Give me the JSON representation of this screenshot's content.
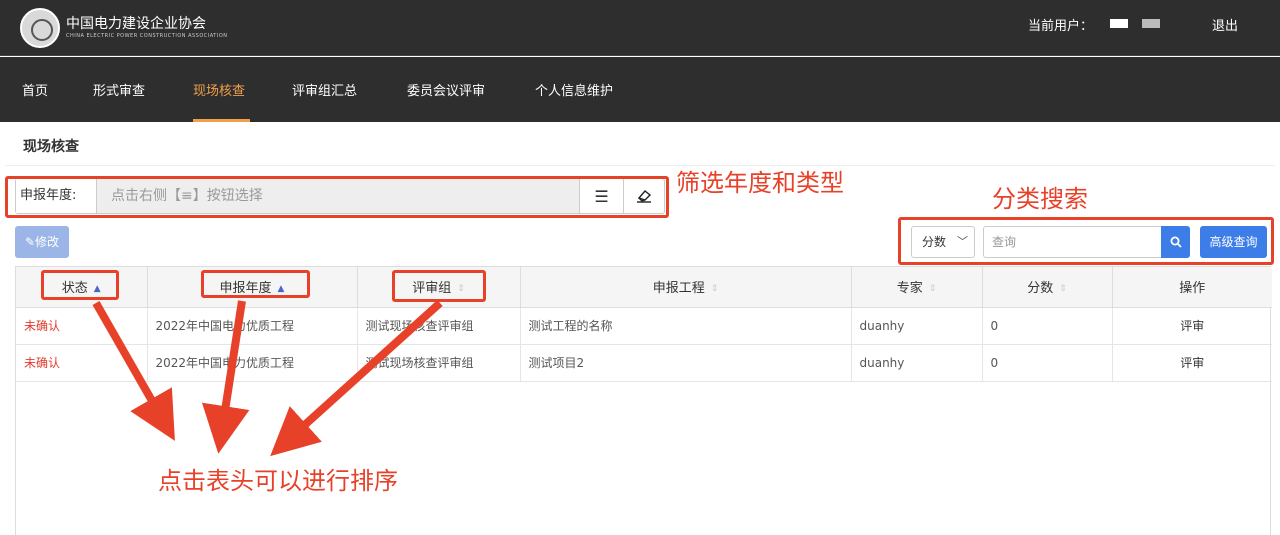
{
  "header": {
    "org_name": "中国电力建设企业协会",
    "org_name_en": "CHINA ELECTRIC POWER CONSTRUCTION ASSOCIATION",
    "current_user_label": "当前用户：",
    "logout": "退出"
  },
  "nav": {
    "items": [
      {
        "label": "首页"
      },
      {
        "label": "形式审查"
      },
      {
        "label": "现场核查"
      },
      {
        "label": "评审组汇总"
      },
      {
        "label": "委员会议评审"
      },
      {
        "label": "个人信息维护"
      }
    ],
    "active": "现场核查"
  },
  "page": {
    "title": "现场核查"
  },
  "filter": {
    "label": "申报年度:",
    "placeholder": "点击右侧【≡】按钮选择",
    "list_icon": "list-icon",
    "eraser_icon": "eraser-icon"
  },
  "toolbar": {
    "edit_label": "修改",
    "edit_icon": "pencil-icon",
    "search_field": "分数",
    "search_placeholder": "查询",
    "search_icon": "search-icon",
    "advanced_label": "高级查询"
  },
  "table": {
    "columns": [
      "状态",
      "申报年度",
      "评审组",
      "申报工程",
      "专家",
      "分数",
      "操作"
    ],
    "rows": [
      [
        "未确认",
        "2022年中国电力优质工程",
        "测试现场核查评审组",
        "测试工程的名称",
        "duanhy",
        "0",
        "评审"
      ],
      [
        "未确认",
        "2022年中国电力优质工程",
        "测试现场核查评审组",
        "测试项目2",
        "duanhy",
        "0",
        "评审"
      ]
    ]
  },
  "annotations": {
    "filter_note": "筛选年度和类型",
    "search_note": "分类搜索",
    "sort_note": "点击表头可以进行排序"
  },
  "colors": {
    "header_bg": "#2e2e2e",
    "nav_active": "#f0a04b",
    "primary": "#3d7de8",
    "status_red": "#e23a2c",
    "annotation_red": "#e8412a"
  }
}
